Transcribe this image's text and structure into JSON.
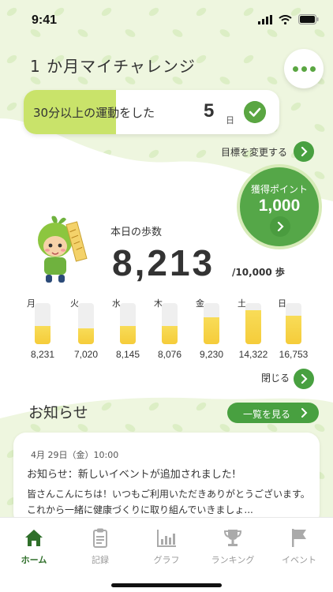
{
  "status_bar": {
    "time": "9:41"
  },
  "challenge": {
    "title": "1 か月マイチャレンジ",
    "goal_text": "30分以上の運動をした",
    "days": "5",
    "days_unit": "日",
    "progress": 0.36,
    "change_goal_label": "目標を変更する"
  },
  "points": {
    "label": "獲得ポイント",
    "value": "1,000"
  },
  "steps": {
    "label": "本日の歩数",
    "value": "8,213",
    "goal": "/10,000 歩"
  },
  "week": {
    "days": [
      {
        "label": "月",
        "value": "8,231",
        "fill": 0.45
      },
      {
        "label": "火",
        "value": "7,020",
        "fill": 0.38
      },
      {
        "label": "水",
        "value": "8,145",
        "fill": 0.45
      },
      {
        "label": "木",
        "value": "8,076",
        "fill": 0.44
      },
      {
        "label": "金",
        "value": "9,230",
        "fill": 0.65
      },
      {
        "label": "土",
        "value": "14,322",
        "fill": 0.83
      },
      {
        "label": "日",
        "value": "16,753",
        "fill": 0.7
      }
    ],
    "close_label": "閉じる"
  },
  "news": {
    "title": "お知らせ",
    "view_all_label": "一覧を見る",
    "items": [
      {
        "date": "4月 29日（金）10:00",
        "headline": "お知らせ：新しいイベントが追加されました!",
        "body": "皆さんこんにちは！いつもご利用いただきありがとうございます。これから一緒に健康づくりに取り組んでいきましょ..."
      }
    ]
  },
  "tabs": [
    {
      "label": "ホーム",
      "icon": "home-icon",
      "active": true
    },
    {
      "label": "記録",
      "icon": "clipboard-icon",
      "active": false
    },
    {
      "label": "グラフ",
      "icon": "graph-icon",
      "active": false
    },
    {
      "label": "ランキング",
      "icon": "trophy-icon",
      "active": false
    },
    {
      "label": "イベント",
      "icon": "flag-icon",
      "active": false
    }
  ],
  "colors": {
    "primary_green": "#48a040",
    "goal_fill": "#c9e36a",
    "bar_yellow": "#f5cc3a",
    "active_tab": "#2f6f2a"
  }
}
